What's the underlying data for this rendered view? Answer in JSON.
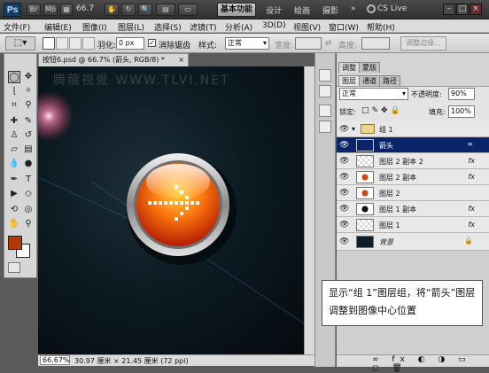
{
  "app": {
    "logo": "Ps",
    "zoom_display": "66.7",
    "workspaces": {
      "active": "基本功能",
      "others": [
        "设计",
        "绘画",
        "摄影"
      ],
      "more": "»"
    },
    "cslive": "CS Live"
  },
  "menu": [
    "文件(F)",
    "编辑(E)",
    "图像(I)",
    "图层(L)",
    "选择(S)",
    "滤镜(T)",
    "分析(A)",
    "3D(D)",
    "视图(V)",
    "窗口(W)",
    "帮助(H)"
  ],
  "options": {
    "feather_label": "羽化:",
    "feather_value": "0 px",
    "antialias_label": "消除锯齿",
    "style_label": "样式:",
    "style_value": "正常",
    "width_label": "宽度:",
    "height_label": "高度:",
    "refine_button": "调整边缘..."
  },
  "document": {
    "tab_title": "按钮6.psd @ 66.7% (箭头, RGB/8) *",
    "zoom_field": "66.67%",
    "doc_size": "30.97 厘米 × 21.45 厘米 (72 ppi)",
    "watermark": "腾龍視覺 WWW.TLVI.NET"
  },
  "panel": {
    "tabs_top": [
      "调整",
      "蒙版"
    ],
    "tabs_layers": [
      "图层",
      "通道",
      "路径"
    ],
    "blend_mode": "正常",
    "opacity_label": "不透明度:",
    "opacity_value": "90%",
    "lock_label": "锁定:",
    "fill_label": "填充:",
    "fill_value": "100%"
  },
  "layers": [
    {
      "name": "组 1",
      "type": "group",
      "fx": false,
      "selected": false
    },
    {
      "name": "箭头",
      "type": "layer",
      "fx": false,
      "selected": true
    },
    {
      "name": "图层 2 副本 2",
      "type": "layer",
      "fx": true,
      "selected": false
    },
    {
      "name": "图层 2 副本",
      "type": "layer",
      "fx": true,
      "selected": false
    },
    {
      "name": "图层 2",
      "type": "layer",
      "fx": false,
      "selected": false
    },
    {
      "name": "图层 1 副本",
      "type": "layer",
      "fx": true,
      "selected": false
    },
    {
      "name": "图层 1",
      "type": "layer",
      "fx": true,
      "selected": false
    },
    {
      "name": "背景",
      "type": "background",
      "fx": false,
      "selected": false
    }
  ],
  "fx_label": "fx",
  "caption": "显示“组 1”图层组，将“箭头”图层调整到图像中心位置",
  "colors": {
    "foreground": "#b23a00",
    "background": "#ffffff",
    "selection": "#0a246a"
  }
}
